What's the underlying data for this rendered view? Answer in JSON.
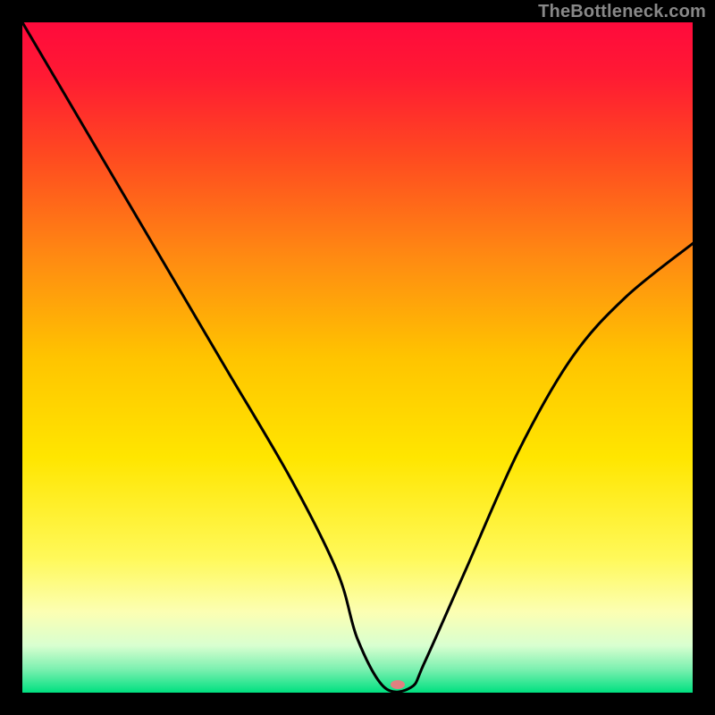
{
  "watermark": "TheBottleneck.com",
  "chart_data": {
    "type": "line",
    "title": "",
    "xlabel": "",
    "ylabel": "",
    "xlim": [
      0,
      100
    ],
    "ylim": [
      0,
      100
    ],
    "gradient_stops": [
      {
        "offset": 0.0,
        "color": "#ff0a3c"
      },
      {
        "offset": 0.08,
        "color": "#ff1a33"
      },
      {
        "offset": 0.2,
        "color": "#ff4a20"
      },
      {
        "offset": 0.35,
        "color": "#ff8a12"
      },
      {
        "offset": 0.5,
        "color": "#ffc400"
      },
      {
        "offset": 0.65,
        "color": "#ffe600"
      },
      {
        "offset": 0.8,
        "color": "#fff95a"
      },
      {
        "offset": 0.88,
        "color": "#fcffb3"
      },
      {
        "offset": 0.93,
        "color": "#d8ffd0"
      },
      {
        "offset": 0.965,
        "color": "#7cf0b0"
      },
      {
        "offset": 1.0,
        "color": "#00e080"
      }
    ],
    "series": [
      {
        "name": "bottleneck-curve",
        "x": [
          0,
          10,
          20,
          30,
          40,
          47,
          50,
          54,
          58,
          60,
          66,
          74,
          82,
          90,
          100
        ],
        "values": [
          100,
          83,
          66,
          49,
          32,
          18,
          8,
          0.8,
          0.8,
          4.5,
          18,
          36,
          50,
          59,
          67
        ]
      }
    ],
    "marker": {
      "x": 56,
      "y": 1.2,
      "color": "#e08080",
      "rx": 8,
      "ry": 5
    }
  }
}
